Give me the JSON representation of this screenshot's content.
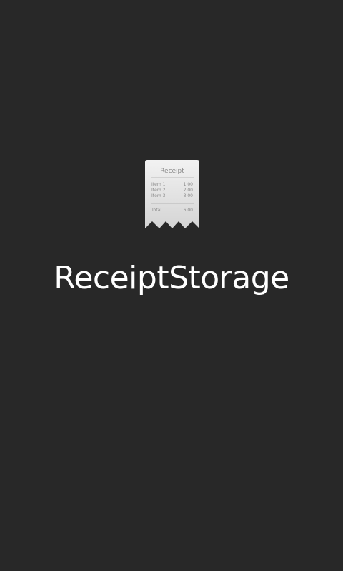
{
  "app": {
    "title": "ReceiptStorage"
  },
  "logo": {
    "icon": "receipt-icon",
    "heading": "Receipt",
    "items": [
      {
        "label": "Item 1",
        "amount": "1.00"
      },
      {
        "label": "Item 2",
        "amount": "2.00"
      },
      {
        "label": "Item 3",
        "amount": "3.00"
      }
    ],
    "total_label": "Total",
    "total_amount": "6.00"
  },
  "colors": {
    "background": "#282828",
    "title": "#ffffff",
    "paper": "#e8e8e8",
    "ink": "#8a8a8a"
  }
}
